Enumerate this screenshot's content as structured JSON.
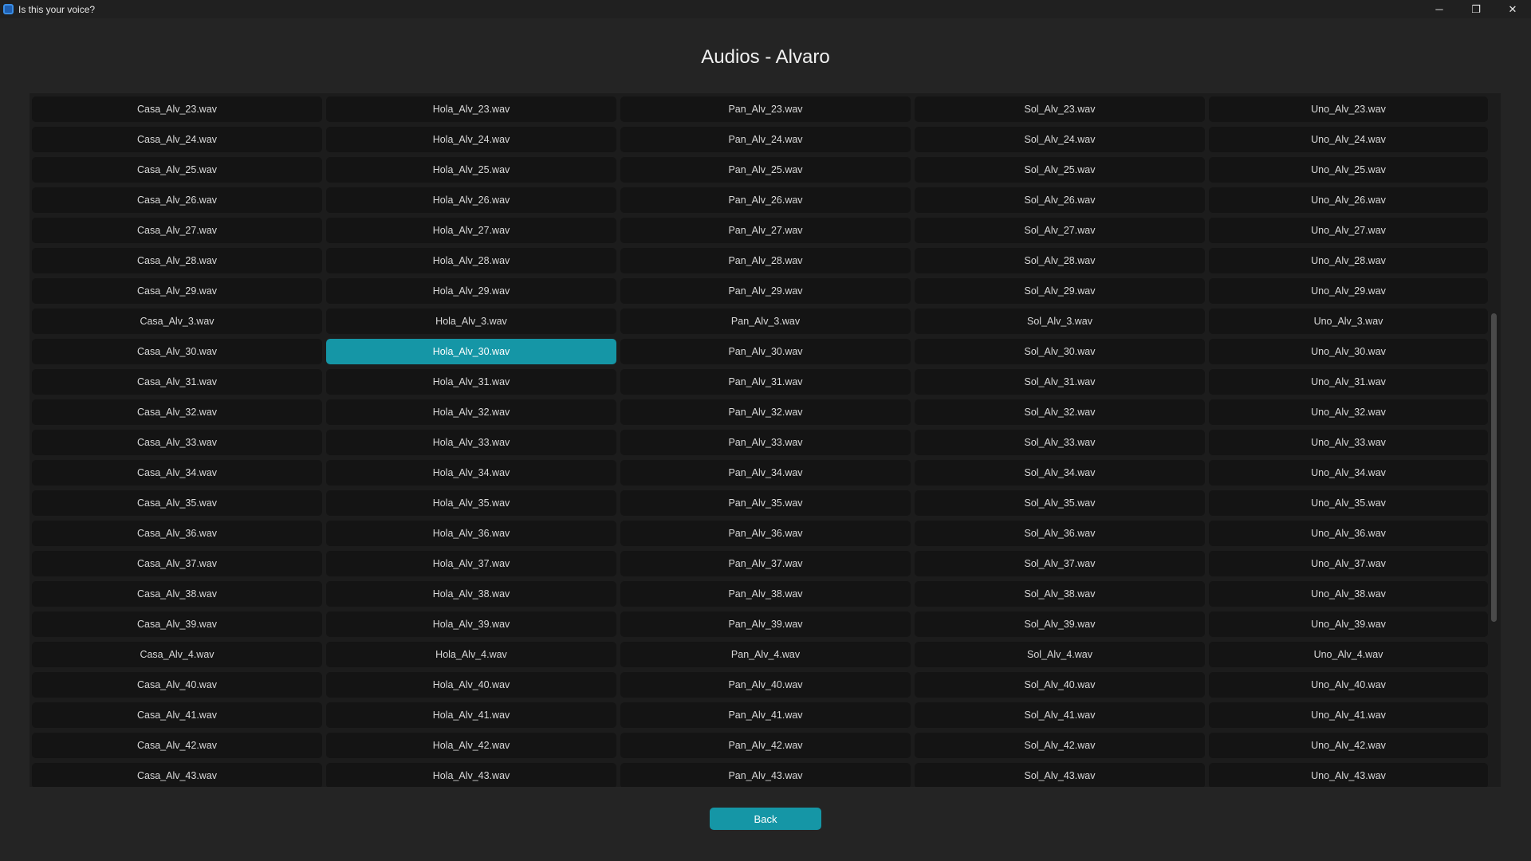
{
  "window": {
    "title": "Is this your voice?",
    "controls": {
      "minimize_icon": "─",
      "restore_icon": "❐",
      "close_icon": "✕"
    }
  },
  "page": {
    "title": "Audios - Alvaro"
  },
  "colors": {
    "accent": "#1596a6",
    "cell_bg": "#141414",
    "window_bg": "#242424"
  },
  "grid": {
    "selected": "Hola_Alv_30.wav",
    "rows": [
      [
        "Casa_Alv_23.wav",
        "Hola_Alv_23.wav",
        "Pan_Alv_23.wav",
        "Sol_Alv_23.wav",
        "Uno_Alv_23.wav"
      ],
      [
        "Casa_Alv_24.wav",
        "Hola_Alv_24.wav",
        "Pan_Alv_24.wav",
        "Sol_Alv_24.wav",
        "Uno_Alv_24.wav"
      ],
      [
        "Casa_Alv_25.wav",
        "Hola_Alv_25.wav",
        "Pan_Alv_25.wav",
        "Sol_Alv_25.wav",
        "Uno_Alv_25.wav"
      ],
      [
        "Casa_Alv_26.wav",
        "Hola_Alv_26.wav",
        "Pan_Alv_26.wav",
        "Sol_Alv_26.wav",
        "Uno_Alv_26.wav"
      ],
      [
        "Casa_Alv_27.wav",
        "Hola_Alv_27.wav",
        "Pan_Alv_27.wav",
        "Sol_Alv_27.wav",
        "Uno_Alv_27.wav"
      ],
      [
        "Casa_Alv_28.wav",
        "Hola_Alv_28.wav",
        "Pan_Alv_28.wav",
        "Sol_Alv_28.wav",
        "Uno_Alv_28.wav"
      ],
      [
        "Casa_Alv_29.wav",
        "Hola_Alv_29.wav",
        "Pan_Alv_29.wav",
        "Sol_Alv_29.wav",
        "Uno_Alv_29.wav"
      ],
      [
        "Casa_Alv_3.wav",
        "Hola_Alv_3.wav",
        "Pan_Alv_3.wav",
        "Sol_Alv_3.wav",
        "Uno_Alv_3.wav"
      ],
      [
        "Casa_Alv_30.wav",
        "Hola_Alv_30.wav",
        "Pan_Alv_30.wav",
        "Sol_Alv_30.wav",
        "Uno_Alv_30.wav"
      ],
      [
        "Casa_Alv_31.wav",
        "Hola_Alv_31.wav",
        "Pan_Alv_31.wav",
        "Sol_Alv_31.wav",
        "Uno_Alv_31.wav"
      ],
      [
        "Casa_Alv_32.wav",
        "Hola_Alv_32.wav",
        "Pan_Alv_32.wav",
        "Sol_Alv_32.wav",
        "Uno_Alv_32.wav"
      ],
      [
        "Casa_Alv_33.wav",
        "Hola_Alv_33.wav",
        "Pan_Alv_33.wav",
        "Sol_Alv_33.wav",
        "Uno_Alv_33.wav"
      ],
      [
        "Casa_Alv_34.wav",
        "Hola_Alv_34.wav",
        "Pan_Alv_34.wav",
        "Sol_Alv_34.wav",
        "Uno_Alv_34.wav"
      ],
      [
        "Casa_Alv_35.wav",
        "Hola_Alv_35.wav",
        "Pan_Alv_35.wav",
        "Sol_Alv_35.wav",
        "Uno_Alv_35.wav"
      ],
      [
        "Casa_Alv_36.wav",
        "Hola_Alv_36.wav",
        "Pan_Alv_36.wav",
        "Sol_Alv_36.wav",
        "Uno_Alv_36.wav"
      ],
      [
        "Casa_Alv_37.wav",
        "Hola_Alv_37.wav",
        "Pan_Alv_37.wav",
        "Sol_Alv_37.wav",
        "Uno_Alv_37.wav"
      ],
      [
        "Casa_Alv_38.wav",
        "Hola_Alv_38.wav",
        "Pan_Alv_38.wav",
        "Sol_Alv_38.wav",
        "Uno_Alv_38.wav"
      ],
      [
        "Casa_Alv_39.wav",
        "Hola_Alv_39.wav",
        "Pan_Alv_39.wav",
        "Sol_Alv_39.wav",
        "Uno_Alv_39.wav"
      ],
      [
        "Casa_Alv_4.wav",
        "Hola_Alv_4.wav",
        "Pan_Alv_4.wav",
        "Sol_Alv_4.wav",
        "Uno_Alv_4.wav"
      ],
      [
        "Casa_Alv_40.wav",
        "Hola_Alv_40.wav",
        "Pan_Alv_40.wav",
        "Sol_Alv_40.wav",
        "Uno_Alv_40.wav"
      ],
      [
        "Casa_Alv_41.wav",
        "Hola_Alv_41.wav",
        "Pan_Alv_41.wav",
        "Sol_Alv_41.wav",
        "Uno_Alv_41.wav"
      ],
      [
        "Casa_Alv_42.wav",
        "Hola_Alv_42.wav",
        "Pan_Alv_42.wav",
        "Sol_Alv_42.wav",
        "Uno_Alv_42.wav"
      ],
      [
        "Casa_Alv_43.wav",
        "Hola_Alv_43.wav",
        "Pan_Alv_43.wav",
        "Sol_Alv_43.wav",
        "Uno_Alv_43.wav"
      ]
    ]
  },
  "footer": {
    "back_label": "Back"
  }
}
